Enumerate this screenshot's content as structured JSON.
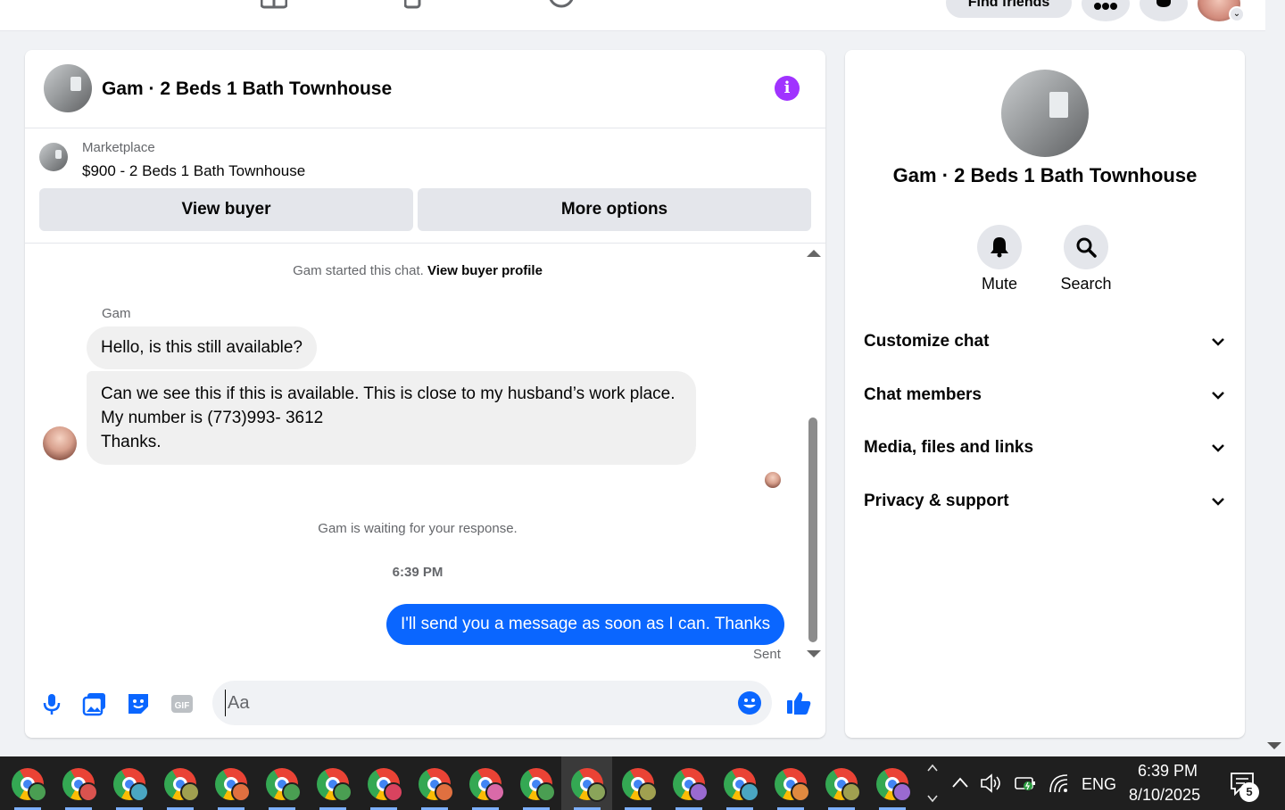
{
  "topbar": {
    "find_friends_label": "Find friends"
  },
  "chat": {
    "header_title": "Gam · 2 Beds 1 Bath Townhouse",
    "marketplace_label": "Marketplace",
    "listing_title": "$900 - 2 Beds 1 Bath Townhouse",
    "view_buyer_label": "View buyer",
    "more_options_label": "More options",
    "started_text": "Gam started this chat.",
    "view_buyer_profile_label": "View buyer profile",
    "sender_name": "Gam",
    "messages_in": [
      "Hello, is this still available?",
      "Can we see this if this is available. This is close to my husband’s work place. My number is (773)993- 3612",
      "Thanks."
    ],
    "waiting_text": "Gam is waiting for your response.",
    "timestamp": "6:39 PM",
    "message_out": "I'll send you a message as soon as I can. Thanks",
    "sent_status": "Sent",
    "composer_placeholder": "Aa",
    "composer_value": ""
  },
  "info_panel": {
    "title": "Gam · 2 Beds 1 Bath Townhouse",
    "actions": [
      {
        "label": "Mute",
        "icon": "bell-icon"
      },
      {
        "label": "Search",
        "icon": "search-icon"
      }
    ],
    "sections": [
      {
        "label": "Customize chat"
      },
      {
        "label": "Chat members"
      },
      {
        "label": "Media, files and links"
      },
      {
        "label": "Privacy & support"
      }
    ]
  },
  "taskbar": {
    "language": "ENG",
    "time": "6:39 PM",
    "date": "8/10/2025",
    "notification_count": "5",
    "apps": [
      {
        "badge": "#4a9e52"
      },
      {
        "badge": "#d9534f"
      },
      {
        "badge": "#4aa6c2"
      },
      {
        "badge": "#a0a050"
      },
      {
        "badge": "#e07040"
      },
      {
        "badge": "#4a9e52"
      },
      {
        "badge": "#4a9e52"
      },
      {
        "badge": "#d9435f"
      },
      {
        "badge": "#e07040"
      },
      {
        "badge": "#d96aa8"
      },
      {
        "badge": "#4a9e52"
      },
      {
        "badge": "#8aa45a"
      },
      {
        "badge": "#a0a050"
      },
      {
        "badge": "#9a6ad0"
      },
      {
        "badge": "#4aa6c2"
      },
      {
        "badge": "#e08a40"
      },
      {
        "badge": "#a0a050"
      },
      {
        "badge": "#9a6ad0"
      }
    ],
    "active_app_index": 11
  },
  "colors": {
    "accent_blue": "#0a66ff",
    "info_purple": "#a033ff",
    "panel_bg": "#ffffff",
    "page_bg": "#f0f2f5"
  }
}
